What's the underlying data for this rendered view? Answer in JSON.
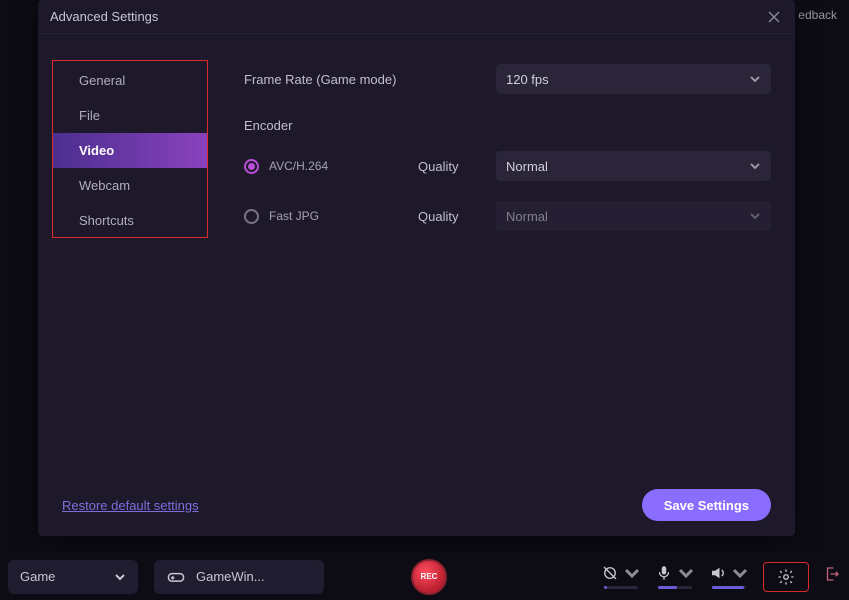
{
  "topbar": {
    "feedback": "edback"
  },
  "modal": {
    "title": "Advanced Settings",
    "sidebar": {
      "items": [
        {
          "label": "General"
        },
        {
          "label": "File"
        },
        {
          "label": "Video",
          "active": true
        },
        {
          "label": "Webcam"
        },
        {
          "label": "Shortcuts"
        }
      ]
    },
    "frameRate": {
      "label": "Frame Rate (Game mode)",
      "value": "120 fps"
    },
    "encoder": {
      "label": "Encoder",
      "options": [
        {
          "label": "AVC/H.264",
          "selected": true,
          "quality": {
            "label": "Quality",
            "value": "Normal",
            "enabled": true
          }
        },
        {
          "label": "Fast JPG",
          "selected": false,
          "quality": {
            "label": "Quality",
            "value": "Normal",
            "enabled": false
          }
        }
      ]
    },
    "footer": {
      "restore": "Restore default settings",
      "save": "Save Settings"
    }
  },
  "bottombar": {
    "mode": "Game",
    "gameWindow": "GameWin...",
    "rec": "REC",
    "audioLevels": {
      "camera": 10,
      "mic": 55,
      "speaker": 95
    }
  },
  "colors": {
    "accent": "#8a6cff",
    "highlight": "#d92b2b",
    "radio": "#b94ed8"
  }
}
